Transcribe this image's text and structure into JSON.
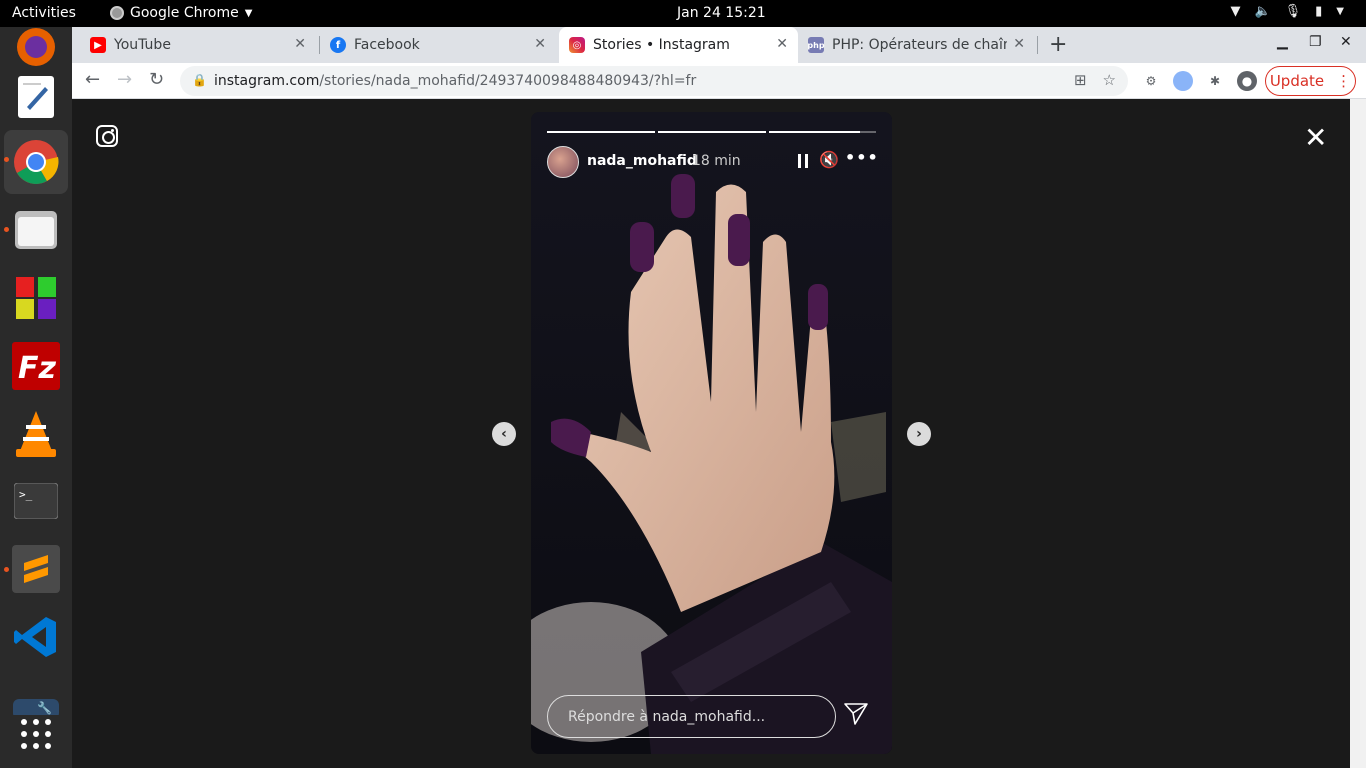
{
  "topbar": {
    "activities": "Activities",
    "app_name": "Google Chrome",
    "clock": "Jan 24  15:21"
  },
  "dock": {
    "items": [
      "firefox",
      "text-editor",
      "google-chrome",
      "files",
      "rubiks-cube",
      "filezilla",
      "vlc",
      "terminal",
      "sublime-text",
      "vscode",
      "tools",
      "show-applications"
    ]
  },
  "tabs": [
    {
      "label": "YouTube",
      "favicon_color": "#ff0000"
    },
    {
      "label": "Facebook",
      "favicon_color": "#1877f2"
    },
    {
      "label": "Stories • Instagram",
      "favicon_color": "#d6249f"
    },
    {
      "label": "PHP: Opérateurs de chaîn",
      "favicon_color": "#777bb3"
    }
  ],
  "toolbar": {
    "url_host": "instagram.com",
    "url_path": "/stories/nada_mohafid/2493740098488480943/?hl=fr",
    "update_label": "Update"
  },
  "story": {
    "username": "nada_mohafid",
    "time_ago": "18 min",
    "reply_placeholder": "Répondre à nada_mohafid...",
    "progress": [
      1,
      1,
      0.85
    ]
  },
  "colors": {
    "accent_update": "#d93025",
    "dock_active_dot": "#e95420",
    "nail_polish": "#4a1a4d"
  }
}
